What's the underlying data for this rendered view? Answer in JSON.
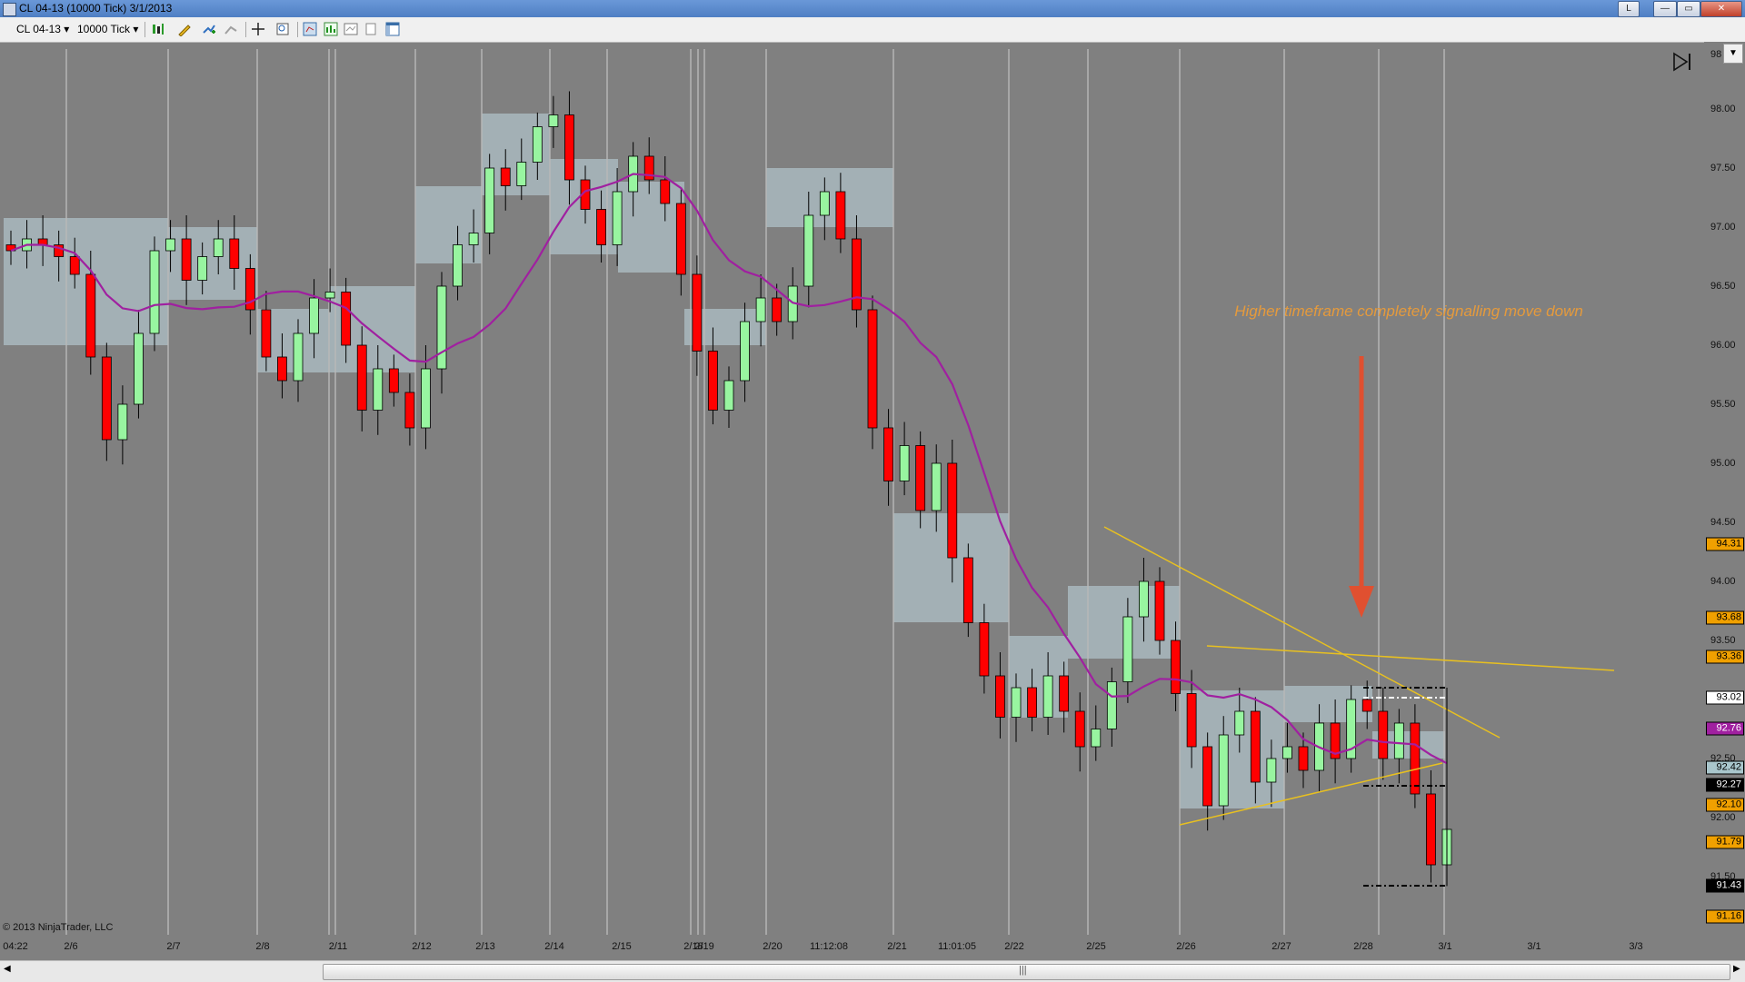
{
  "window": {
    "title": "CL 04-13 (10000 Tick)  3/1/2013",
    "buttons": [
      "L",
      "—",
      "▭",
      "✕"
    ]
  },
  "toolbar": {
    "instrument": "CL 04-13",
    "interval": "10000 Tick"
  },
  "chart": {
    "copyright": "© 2013 NinjaTrader, LLC",
    "annotation": "Higher timeframe completely signalling move down",
    "colors": {
      "background": "#808080",
      "up_candle": "#98f5a0",
      "down_candle": "#ff0000",
      "moving_average": "#a020a0",
      "trendline": "#e8c020",
      "zone": "#a9b9be",
      "arrow": "#e05030",
      "annotation_text": "#e59a3c"
    },
    "icons": [
      "play-to-end-icon",
      "dropdown-arrow-icon"
    ]
  },
  "chart_data": {
    "type": "candlestick",
    "title": "CL 04-13 (10000 Tick)",
    "x_tick_labels": [
      "04:22",
      "2/6",
      "2/7",
      "2/8",
      "2/11",
      "2/12",
      "2/13",
      "2/14",
      "2/15",
      "2/18",
      "2/19",
      "2/20",
      "11:12:08",
      "2/21",
      "11:01:05",
      "2/22",
      "2/25",
      "2/26",
      "2/27",
      "2/28",
      "3/1",
      "3/1",
      "3/3"
    ],
    "y_tick_labels": [
      "98",
      "98.00",
      "97.50",
      "97.00",
      "96.50",
      "96.00",
      "95.50",
      "95.00",
      "94.50",
      "94.00",
      "93.50",
      "93.00",
      "92.50",
      "92.00",
      "91.50"
    ],
    "ylim": [
      91.2,
      98.4
    ],
    "grid": "vertical session lines",
    "price_markers": [
      {
        "label": "94.31",
        "value": 94.31,
        "color": "#f0a000",
        "text_color": "#000000"
      },
      {
        "label": "93.68",
        "value": 93.68,
        "color": "#f0a000",
        "text_color": "#000000"
      },
      {
        "label": "93.36",
        "value": 93.36,
        "color": "#f0a000",
        "text_color": "#000000"
      },
      {
        "label": "93.02",
        "value": 93.02,
        "color": "#ffffff",
        "text_color": "#000000"
      },
      {
        "label": "92.76",
        "value": 92.76,
        "color": "#a020a0",
        "text_color": "#ffffff"
      },
      {
        "label": "92.42",
        "value": 92.42,
        "color": "#a9c6cc",
        "text_color": "#000000"
      },
      {
        "label": "92.27",
        "value": 92.27,
        "color": "#000000",
        "text_color": "#ffffff"
      },
      {
        "label": "92.10",
        "value": 92.1,
        "color": "#f0a000",
        "text_color": "#000000"
      },
      {
        "label": "91.79",
        "value": 91.79,
        "color": "#f0a000",
        "text_color": "#000000"
      },
      {
        "label": "91.43",
        "value": 91.43,
        "color": "#000000",
        "text_color": "#ffffff"
      },
      {
        "label": "91.16",
        "value": 91.16,
        "color": "#f0a000",
        "text_color": "#000000"
      }
    ],
    "close_series": [
      96.8,
      96.9,
      96.85,
      96.75,
      96.6,
      95.9,
      95.2,
      95.5,
      96.1,
      96.8,
      96.9,
      96.55,
      96.75,
      96.9,
      96.65,
      96.3,
      95.9,
      95.7,
      96.1,
      96.4,
      96.45,
      96.0,
      95.45,
      95.8,
      95.6,
      95.3,
      95.8,
      96.5,
      96.85,
      96.95,
      97.5,
      97.35,
      97.55,
      97.85,
      97.95,
      97.4,
      97.15,
      96.85,
      97.3,
      97.6,
      97.4,
      97.2,
      96.6,
      95.95,
      95.45,
      95.7,
      96.2,
      96.4,
      96.2,
      96.5,
      97.1,
      97.3,
      96.9,
      96.3,
      95.3,
      94.85,
      95.15,
      94.6,
      95.0,
      94.2,
      93.65,
      93.2,
      92.85,
      93.1,
      92.85,
      93.2,
      92.9,
      92.6,
      92.75,
      93.15,
      93.7,
      94.0,
      93.5,
      93.05,
      92.6,
      92.1,
      92.7,
      92.9,
      92.3,
      92.5,
      92.6,
      92.4,
      92.8,
      92.5,
      93.0,
      92.9,
      92.5,
      92.8,
      92.2,
      91.6,
      91.9
    ]
  }
}
